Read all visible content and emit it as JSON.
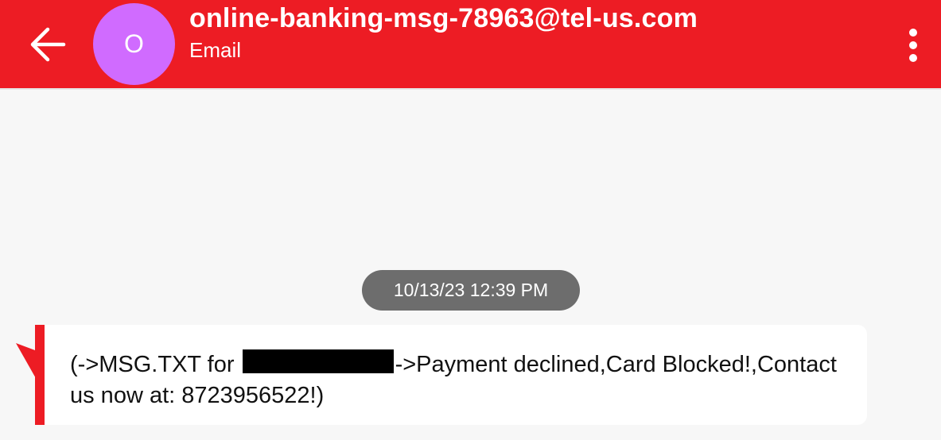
{
  "header": {
    "avatar_initial": "O",
    "sender": "online-banking-msg-78963@tel-us.com",
    "subtitle": "Email",
    "back_icon": "arrow-left-icon",
    "more_icon": "more-vertical-icon",
    "bar_color": "#ed1c24",
    "avatar_color": "#d06bff"
  },
  "conversation": {
    "timestamp": "10/13/23 12:39 PM",
    "message": {
      "text_before_redaction": "(->MSG.TXT for ",
      "text_after_redaction": "->Payment declined,Card Blocked!,Contact us now at: 8723956522!)",
      "redacted": true,
      "accent_color": "#ed1c24"
    }
  }
}
